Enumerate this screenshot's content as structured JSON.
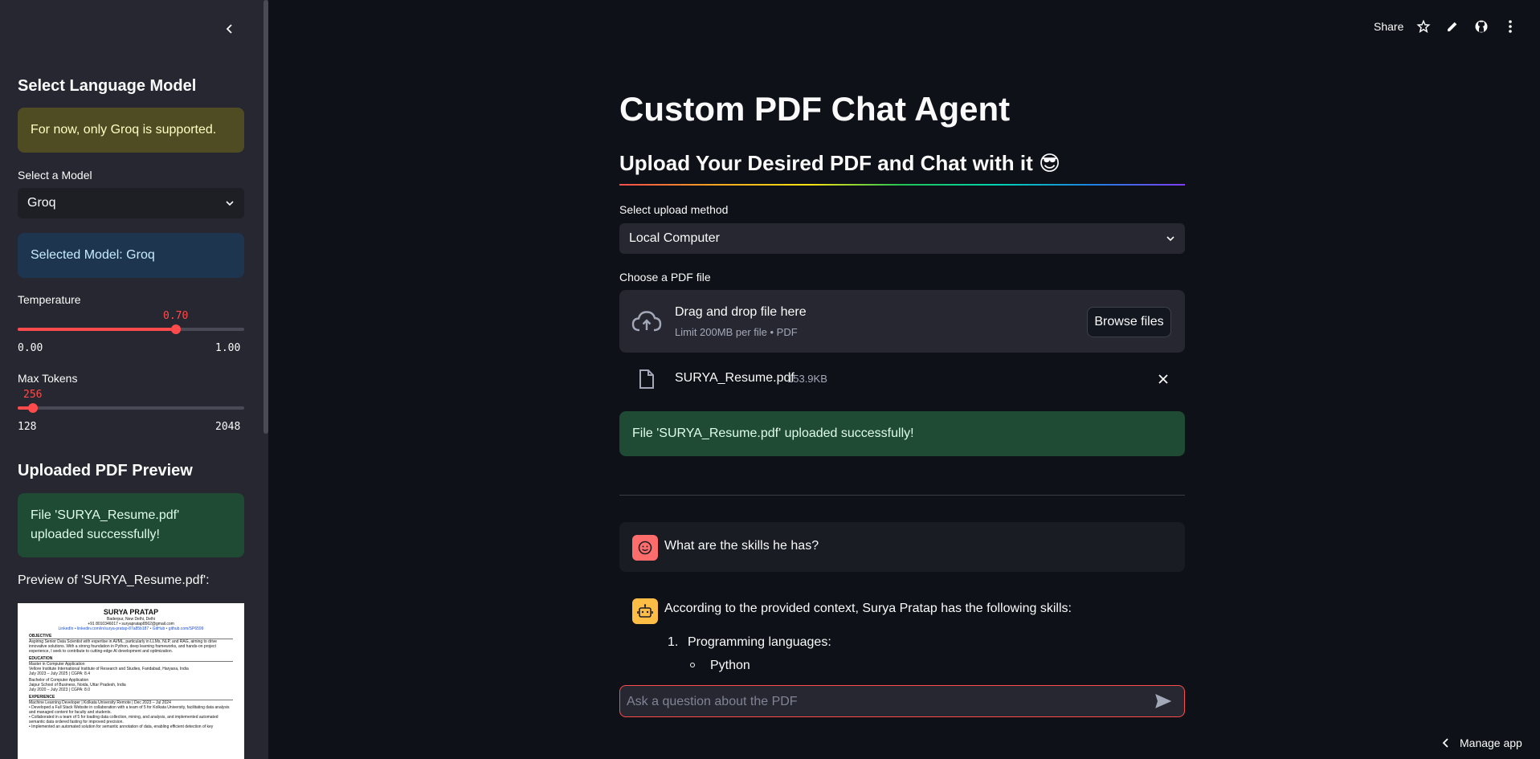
{
  "topbar": {
    "share_label": "Share",
    "icons": [
      "star-icon",
      "pencil-icon",
      "github-icon",
      "more-vertical-icon"
    ]
  },
  "sidebar": {
    "collapse_icon": "chevron-left-icon",
    "section1_title": "Select Language Model",
    "warning_text": "For now, only Groq is supported.",
    "model_select_label": "Select a Model",
    "model_select_value": "Groq",
    "info_text": "Selected Model: Groq",
    "temperature": {
      "label": "Temperature",
      "value": "0.70",
      "min": "0.00",
      "max": "1.00",
      "fraction": 0.7
    },
    "max_tokens": {
      "label": "Max Tokens",
      "value": "256",
      "min": "128",
      "max": "2048",
      "fraction": 0.067
    },
    "section2_title": "Uploaded PDF Preview",
    "success_text": "File 'SURYA_Resume.pdf' uploaded successfully!",
    "preview_label": "Preview of 'SURYA_Resume.pdf':",
    "pdf": {
      "name": "SURYA PRATAP",
      "address": "Baderpur, New Delhi, Delhi",
      "contact": "+91 8010346017 • suryapratap8562@gmail.com",
      "links": "LinkedIn • linkedin.com/in/surya-pratap-87a85b187 • GitHub • github.com/SP6599",
      "objective_h": "OBJECTIVE",
      "objective": "Aspiring Senior Data Scientist with expertise in AI/ML, particularly in LLMs, NLP, and RAG, aiming to drive innovative solutions. With a strong foundation in Python, deep learning frameworks, and hands-on project experience, I seek to contribute to cutting-edge AI development and optimization.",
      "education_h": "EDUCATION",
      "edu1": "Master in Computer Application",
      "edu1b": "Vellore Institute International Institute of Research and Studies, Faridabad, Haryana, India",
      "edu1c": "July 2023 – July 2025 | CGPA: 8.4",
      "edu2": "Bachelor of Computer Application",
      "edu2b": "Jaipur School of Business, Noida, Uttar Pradesh, India",
      "edu2c": "July 2020 – July 2023 | CGPA: 8.0",
      "experience_h": "EXPERIENCE",
      "exp1": "Machine Learning Developer | Kolkata University                                Remote | Dec 2023 – Jul 2024",
      "exp1a": "• Developed a Full Stack Website in collaboration with a team of 5 for Kolkata University, facilitating data analysis and managed content for faculty and students.",
      "exp1b": "• Collaborated in a team of 5 for loading data collection, mining, and analysis, and implemented automated semantic data ordered fasting for improved precision.",
      "exp1c": "• Implemented an automated solution for semantic annotation of data, enabling efficient detection of key"
    }
  },
  "main": {
    "title": "Custom PDF Chat Agent",
    "subtitle": "Upload Your Desired PDF and Chat with it 😎",
    "upload_method_label": "Select upload method",
    "upload_method_value": "Local Computer",
    "file_label": "Choose a PDF file",
    "dropzone_title": "Drag and drop file here",
    "dropzone_limit": "Limit 200MB per file • PDF",
    "browse_label": "Browse files",
    "uploaded_file": {
      "name": "SURYA_Resume.pdf",
      "size": "153.9KB"
    },
    "success_text": "File 'SURYA_Resume.pdf' uploaded successfully!",
    "chat": {
      "user_message": "What are the skills he has?",
      "assistant_intro": "According to the provided context, Surya Pratap has the following skills:",
      "list_num": "1.",
      "list_item_1": "Programming languages:",
      "sub_item_1": "Python"
    },
    "chat_input_placeholder": "Ask a question about the PDF"
  },
  "footer": {
    "manage_app_label": "Manage app"
  },
  "colors": {
    "accent": "#ff4b4b",
    "bg": "#0e1117",
    "sidebar_bg": "#262730",
    "warning_bg": "#4f4c24",
    "info_bg": "#1e3550",
    "success_bg": "#1f4a33"
  }
}
